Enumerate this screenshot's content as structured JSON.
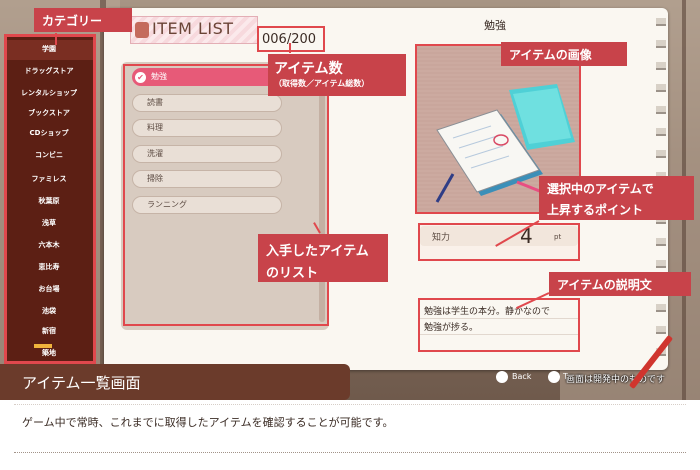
{
  "screen": {
    "title": "ITEM LIST",
    "counter": "006/200",
    "selected_item_name": "勉強",
    "stat": {
      "label": "知力",
      "value": "4",
      "unit": "pt"
    },
    "description": [
      "勉強は学生の本分。静かなので",
      "勉強が捗る。"
    ],
    "categories": [
      "学園",
      "ドラッグストア",
      "レンタルショップ",
      "ブックストア",
      "CDショップ",
      "コンビニ",
      "ファミレス",
      "秋葉原",
      "浅草",
      "六本木",
      "恵比寿",
      "お台場",
      "池袋",
      "新宿",
      "築地"
    ],
    "items": [
      "勉強",
      "読書",
      "料理",
      "洗濯",
      "掃除",
      "ランニング"
    ],
    "nav": {
      "back": "Back",
      "up": "T"
    },
    "dev_notice": "画面は開発中のものです"
  },
  "callouts": {
    "category": "カテゴリー",
    "counter_main": "アイテム数",
    "counter_sub": "（取得数／アイテム総数）",
    "image": "アイテムの画像",
    "list_line1": "入手したアイテム",
    "list_line2": "のリスト",
    "points_line1": "選択中のアイテムで",
    "points_line2": "上昇するポイント",
    "description": "アイテムの説明文"
  },
  "page": {
    "heading": "アイテム一覧画面",
    "caption": "ゲーム中で常時、これまでに取得したアイテムを確認することが可能です。"
  },
  "colors": {
    "accent": "#c8434a",
    "selected": "#e75a78",
    "heading_bg": "#6b3b2b"
  }
}
